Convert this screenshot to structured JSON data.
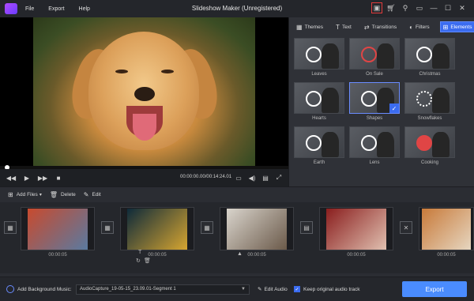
{
  "app": {
    "title": "Slideshow Maker (Unregistered)"
  },
  "menu": {
    "items": [
      "File",
      "Export",
      "Help"
    ]
  },
  "titlebar_icons": [
    "save-icon",
    "cart-icon",
    "key-icon",
    "chat-icon",
    "minimize-icon",
    "maximize-icon",
    "close-icon"
  ],
  "player": {
    "time": "00:00:00.00/00:14:24.01"
  },
  "panel": {
    "tabs": [
      {
        "label": "Themes",
        "icon": "themes-icon",
        "active": false
      },
      {
        "label": "Text",
        "icon": "text-icon",
        "active": false
      },
      {
        "label": "Transitions",
        "icon": "transitions-icon",
        "active": false
      },
      {
        "label": "Filters",
        "icon": "filters-icon",
        "active": false
      },
      {
        "label": "Elements",
        "icon": "elements-icon",
        "active": true
      }
    ],
    "elements": [
      {
        "label": "Leaves",
        "selected": false
      },
      {
        "label": "On Sale",
        "selected": false
      },
      {
        "label": "Christmas",
        "selected": false
      },
      {
        "label": "Hearts",
        "selected": false
      },
      {
        "label": "Shapes",
        "selected": true
      },
      {
        "label": "Snowflakes",
        "selected": false
      },
      {
        "label": "Earth",
        "selected": false
      },
      {
        "label": "Lens",
        "selected": false
      },
      {
        "label": "Cooking",
        "selected": false
      }
    ]
  },
  "timeline_toolbar": {
    "add_files": "Add Files",
    "delete": "Delete",
    "edit": "Edit"
  },
  "storyboard": {
    "clips": [
      {
        "time": "00:00:05",
        "colors": [
          "#c84a2e",
          "#5a7aa0"
        ]
      },
      {
        "time": "00:00:05",
        "colors": [
          "#0e2a3a",
          "#d6a531"
        ]
      },
      {
        "time": "00:00:05",
        "colors": [
          "#d9d4cc",
          "#6b5a4a"
        ]
      },
      {
        "time": "00:00:05",
        "colors": [
          "#8a1e1e",
          "#e0c0b0"
        ]
      },
      {
        "time": "00:00:05",
        "colors": [
          "#c87a3a",
          "#e6d6c0"
        ]
      }
    ]
  },
  "bottom": {
    "music_label": "Add Background Music:",
    "music_value": "AudioCapture_19-05-15_23.09.01-Segment 1",
    "edit_audio": "Edit Audio",
    "keep_audio": "Keep original audio track",
    "export": "Export"
  }
}
